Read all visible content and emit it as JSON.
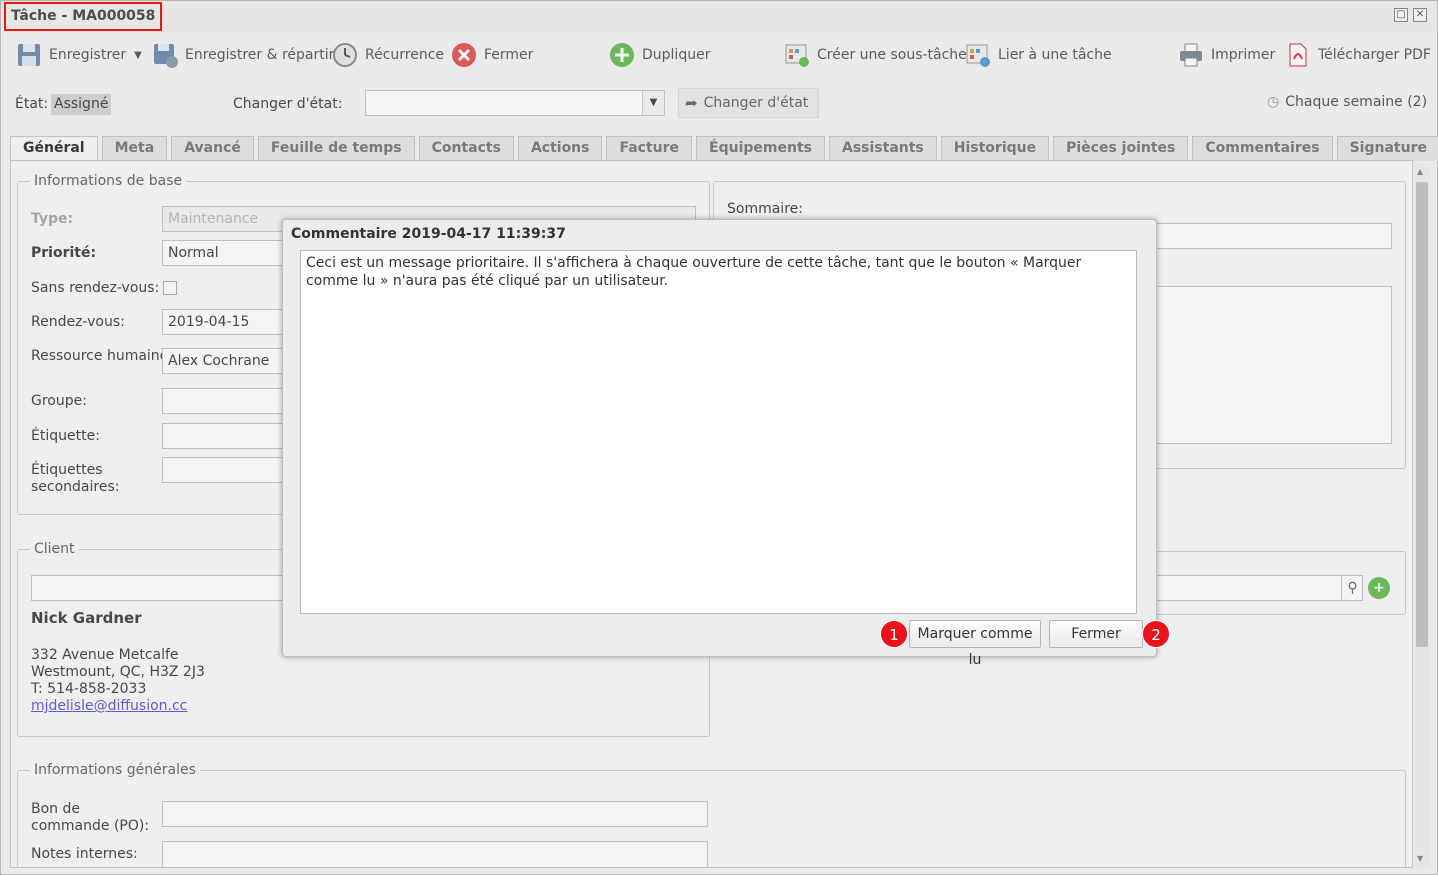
{
  "window": {
    "title": "Tâche - MA000058"
  },
  "toolbar": {
    "save": "Enregistrer",
    "save_dispatch": "Enregistrer & répartir",
    "recurrence": "Récurrence",
    "close": "Fermer",
    "duplicate": "Dupliquer",
    "create_subtask": "Créer une sous-tâche",
    "link_task": "Lier à une tâche",
    "print": "Imprimer",
    "download_pdf": "Télécharger PDF"
  },
  "state": {
    "label": "État:",
    "value": "Assigné",
    "change_label": "Changer d'état:",
    "change_value": "",
    "change_button": "Changer d'état",
    "recurrence_info": "Chaque semaine (2)"
  },
  "tabs": [
    "Général",
    "Meta",
    "Avancé",
    "Feuille de temps",
    "Contacts",
    "Actions",
    "Facture",
    "Équipements",
    "Assistants",
    "Historique",
    "Pièces jointes",
    "Commentaires",
    "Signature"
  ],
  "basic_info": {
    "legend": "Informations de base",
    "type_label": "Type:",
    "type_value": "Maintenance",
    "priority_label": "Priorité:",
    "priority_value": "Normal",
    "no_appointment_label": "Sans rendez-vous:",
    "appointment_label": "Rendez-vous:",
    "appointment_value": "2019-04-15",
    "resource_label": "Ressource humaine:",
    "resource_value": "Alex Cochrane",
    "group_label": "Groupe:",
    "tag_label": "Étiquette:",
    "secondary_tags_label": "Étiquettes secondaires:"
  },
  "summary": {
    "label": "Sommaire:"
  },
  "client": {
    "legend": "Client",
    "name": "Nick Gardner",
    "address1": "332 Avenue Metcalfe",
    "address2": "Westmount, QC, H3Z 2J3",
    "phone": "T: 514-858-2033",
    "email": "mjdelisle@diffusion.cc"
  },
  "general_info": {
    "legend": "Informations générales",
    "po_label": "Bon de commande (PO):",
    "internal_notes_label": "Notes internes:"
  },
  "dialog": {
    "title": "Commentaire 2019-04-17 11:39:37",
    "message": "Ceci est un message prioritaire. Il s'affichera à chaque ouverture de cette tâche, tant que le bouton « Marquer comme lu » n'aura pas été cliqué par un utilisateur.",
    "mark_read": "Marquer comme lu",
    "close": "Fermer",
    "badge1": "1",
    "badge2": "2"
  }
}
